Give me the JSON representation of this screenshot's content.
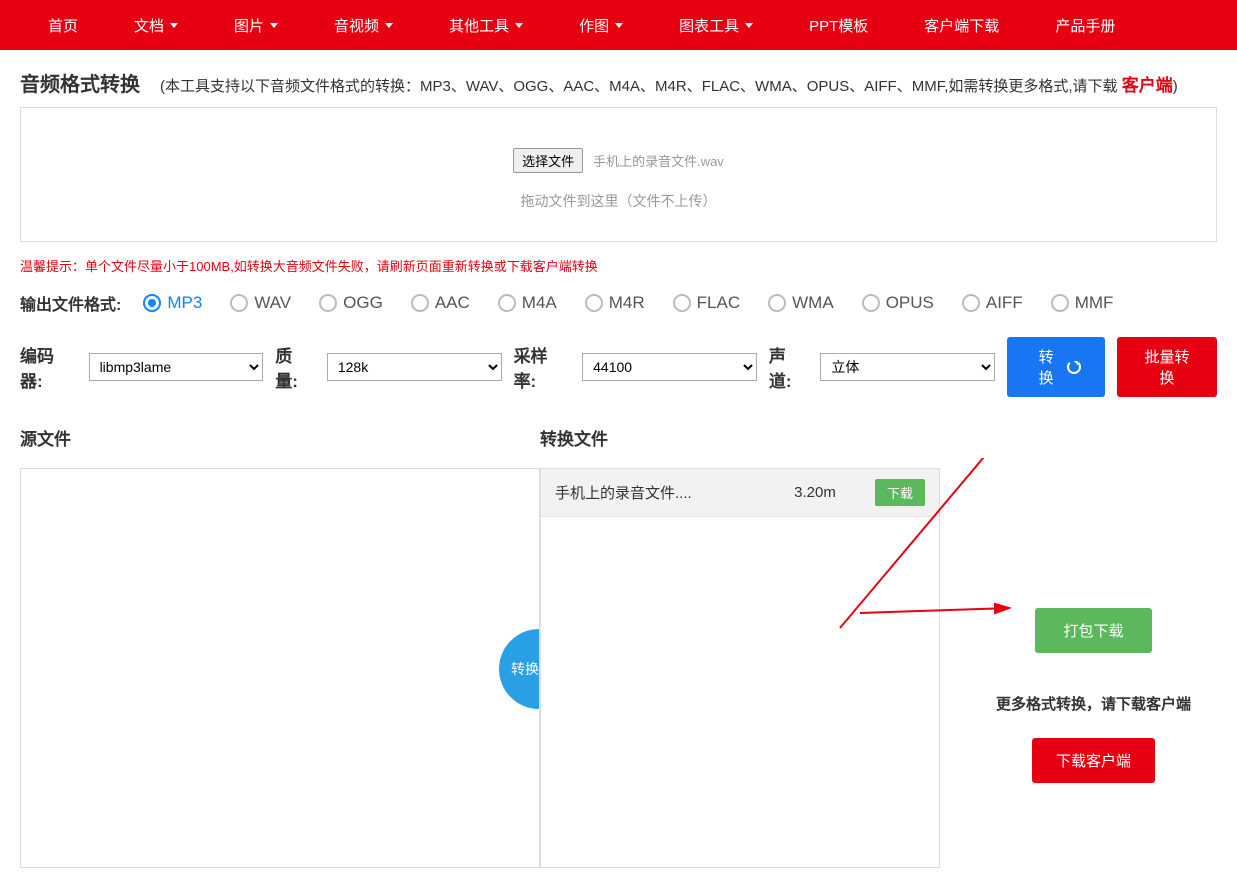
{
  "nav": {
    "items": [
      {
        "label": "首页",
        "dropdown": false
      },
      {
        "label": "文档",
        "dropdown": true
      },
      {
        "label": "图片",
        "dropdown": true
      },
      {
        "label": "音视频",
        "dropdown": true
      },
      {
        "label": "其他工具",
        "dropdown": true
      },
      {
        "label": "作图",
        "dropdown": true
      },
      {
        "label": "图表工具",
        "dropdown": true
      },
      {
        "label": "PPT模板",
        "dropdown": false
      },
      {
        "label": "客户端下载",
        "dropdown": false
      },
      {
        "label": "产品手册",
        "dropdown": false
      }
    ]
  },
  "header": {
    "title": "音频格式转换",
    "subtitle_prefix": "(本工具支持以下音频文件格式的转换：MP3、WAV、OGG、AAC、M4A、M4R、FLAC、WMA、OPUS、AIFF、MMF,如需转换更多格式,请下载 ",
    "client_link": "客户端",
    "subtitle_suffix": ")"
  },
  "upload": {
    "choose_btn": "选择文件",
    "filename": "手机上的录音文件.wav",
    "drag_hint": "拖动文件到这里（文件不上传）"
  },
  "warning": "温馨提示：单个文件尽量小于100MB,如转换大音频文件失败，请刷新页面重新转换或下载客户端转换",
  "formats": {
    "label": "输出文件格式:",
    "options": [
      "MP3",
      "WAV",
      "OGG",
      "AAC",
      "M4A",
      "M4R",
      "FLAC",
      "WMA",
      "OPUS",
      "AIFF",
      "MMF"
    ],
    "selected": "MP3"
  },
  "options": {
    "encoder_label": "编码器:",
    "encoder_value": "libmp3lame",
    "quality_label": "质量:",
    "quality_value": "128k",
    "rate_label": "采样率:",
    "rate_value": "44100",
    "channel_label": "声道:",
    "channel_value": "立体",
    "convert_btn": "转换",
    "batch_btn": "批量转换"
  },
  "panels": {
    "source_label": "源文件",
    "result_label": "转换文件",
    "badge": "转换完毕"
  },
  "result": {
    "filename": "手机上的录音文件....",
    "size": "3.20m",
    "download_btn": "下载"
  },
  "right": {
    "pack_btn": "打包下载",
    "more_text": "更多格式转换，请下载客户端",
    "client_btn": "下载客户端"
  }
}
